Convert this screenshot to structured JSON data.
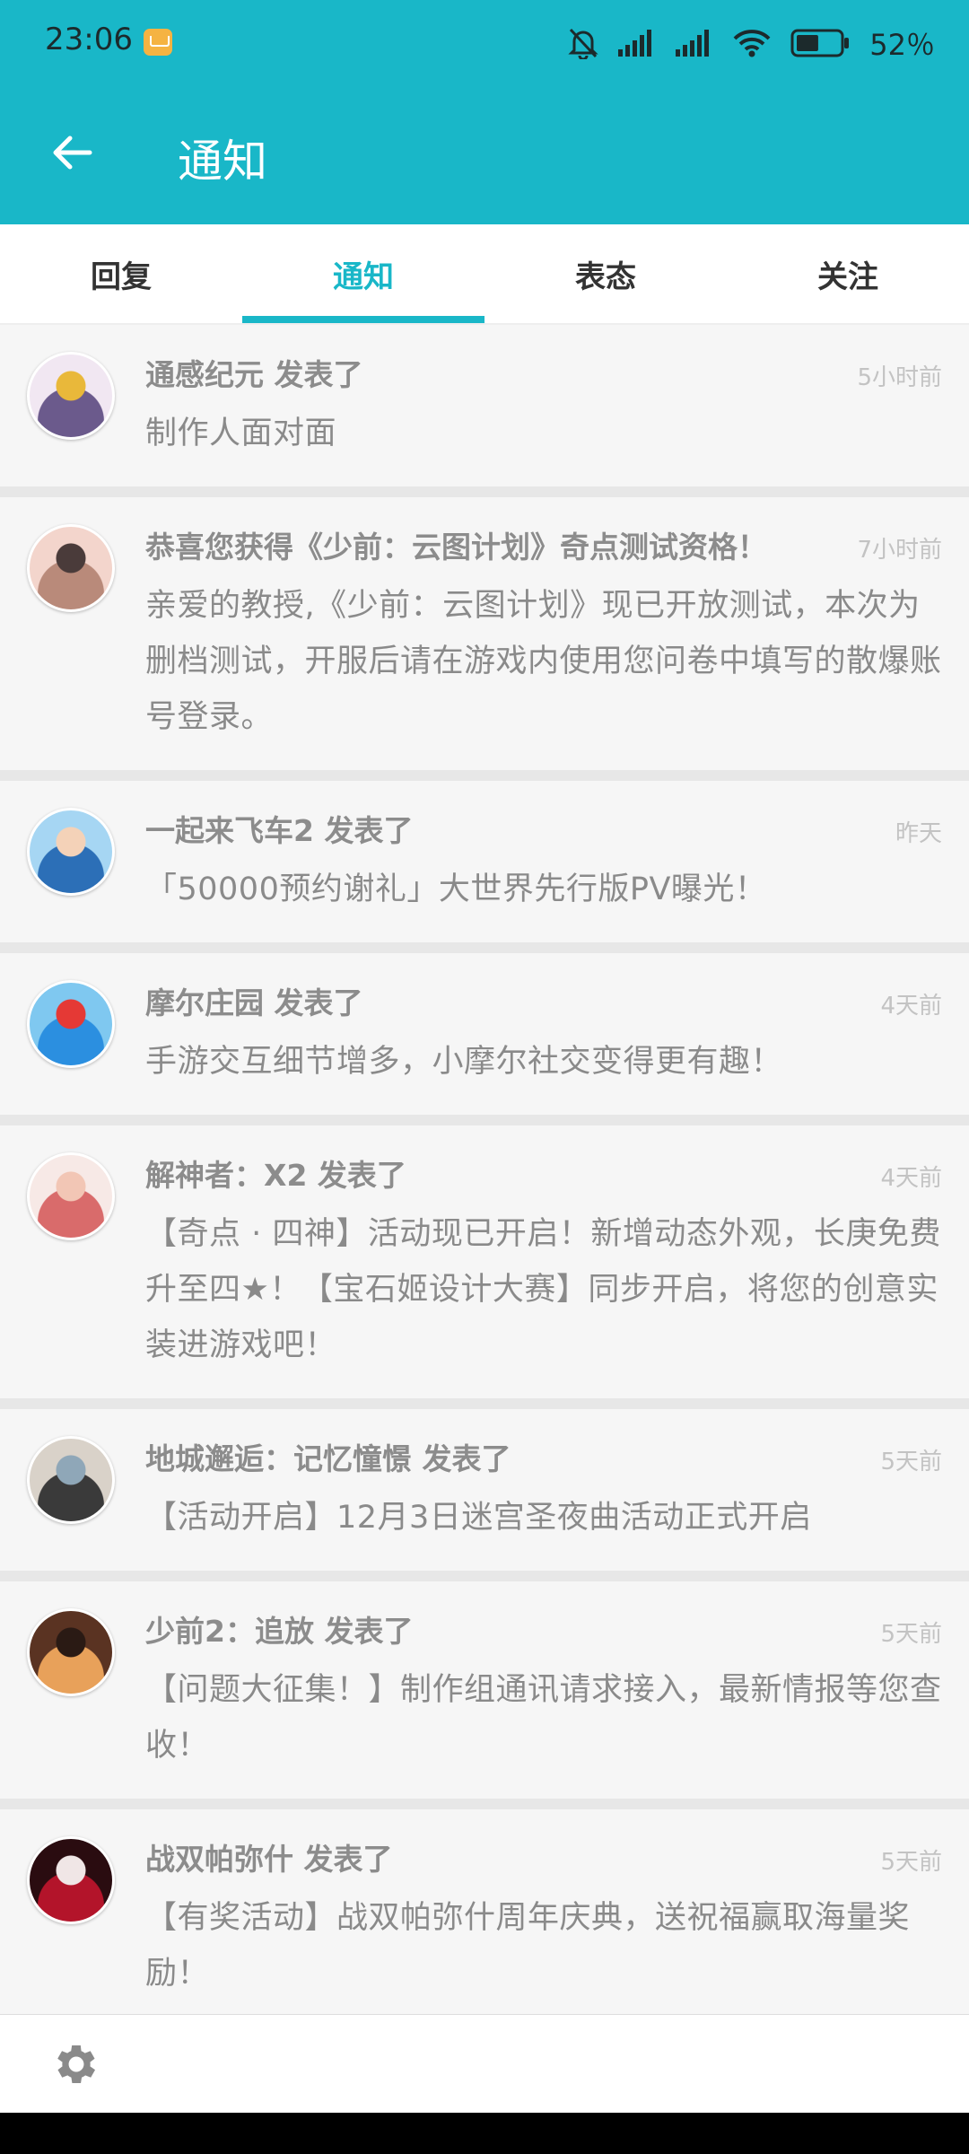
{
  "status_bar": {
    "time": "23:06",
    "notification_icon": "mail-icon",
    "icons": [
      "bell-off-icon",
      "signal-icon",
      "signal-icon",
      "wifi-icon",
      "battery-icon"
    ],
    "battery_percent": "52％",
    "battery_level": 52
  },
  "app_bar": {
    "back_icon": "arrow-left-icon",
    "title": "通知"
  },
  "tabs": [
    {
      "label": "回复",
      "active": false
    },
    {
      "label": "通知",
      "active": true
    },
    {
      "label": "表态",
      "active": false
    },
    {
      "label": "关注",
      "active": false
    }
  ],
  "notifications": [
    {
      "title": "通感纪元 发表了",
      "time": "5小时前",
      "body": "制作人面对面",
      "avatar_colors": [
        "#f1e7f2",
        "#6b5a8c",
        "#e9b83a"
      ]
    },
    {
      "title": "恭喜您获得《少前：云图计划》奇点测试资格！",
      "time": "7小时前",
      "body": "亲爱的教授,《少前：云图计划》现已开放测试，本次为删档测试，开服后请在游戏内使用您问卷中填写的散爆账号登录。",
      "avatar_colors": [
        "#f3d5cc",
        "#b98a7a",
        "#4a3b3a"
      ]
    },
    {
      "title": "一起来飞车2 发表了",
      "time": "昨天",
      "body": "「50000预约谢礼」大世界先行版PV曝光！",
      "avatar_colors": [
        "#a6d6f3",
        "#2c6fb7",
        "#f4d2b8"
      ]
    },
    {
      "title": "摩尔庄园 发表了",
      "time": "4天前",
      "body": "手游交互细节增多，小摩尔社交变得更有趣！",
      "avatar_colors": [
        "#7fc8f0",
        "#2b8fe0",
        "#e53935"
      ]
    },
    {
      "title": "解神者：X2 发表了",
      "time": "4天前",
      "body": "【奇点 · 四神】活动现已开启！新增动态外观，长庚免费升至四★！【宝石姬设计大赛】同步开启，将您的创意实装进游戏吧！",
      "avatar_colors": [
        "#f7e9e6",
        "#d96b6b",
        "#f2c6b5"
      ]
    },
    {
      "title": "地城邂逅：记忆憧憬 发表了",
      "time": "5天前",
      "body": "【活动开启】12月3日迷宫圣夜曲活动正式开启",
      "avatar_colors": [
        "#d9d2c9",
        "#3a3a3a",
        "#8fa7b8"
      ]
    },
    {
      "title": "少前2：追放 发表了",
      "time": "5天前",
      "body": "【问题大征集！】制作组通讯请求接入，最新情报等您查收！",
      "avatar_colors": [
        "#5a3322",
        "#e8a15a",
        "#2a1a14"
      ]
    },
    {
      "title": "战双帕弥什 发表了",
      "time": "5天前",
      "body": "【有奖活动】战双帕弥什周年庆典，送祝福赢取海量奖励！",
      "avatar_colors": [
        "#2a0c10",
        "#b3142a",
        "#f0e6e6"
      ]
    }
  ],
  "bottom_bar": {
    "settings_icon": "gear-icon"
  }
}
